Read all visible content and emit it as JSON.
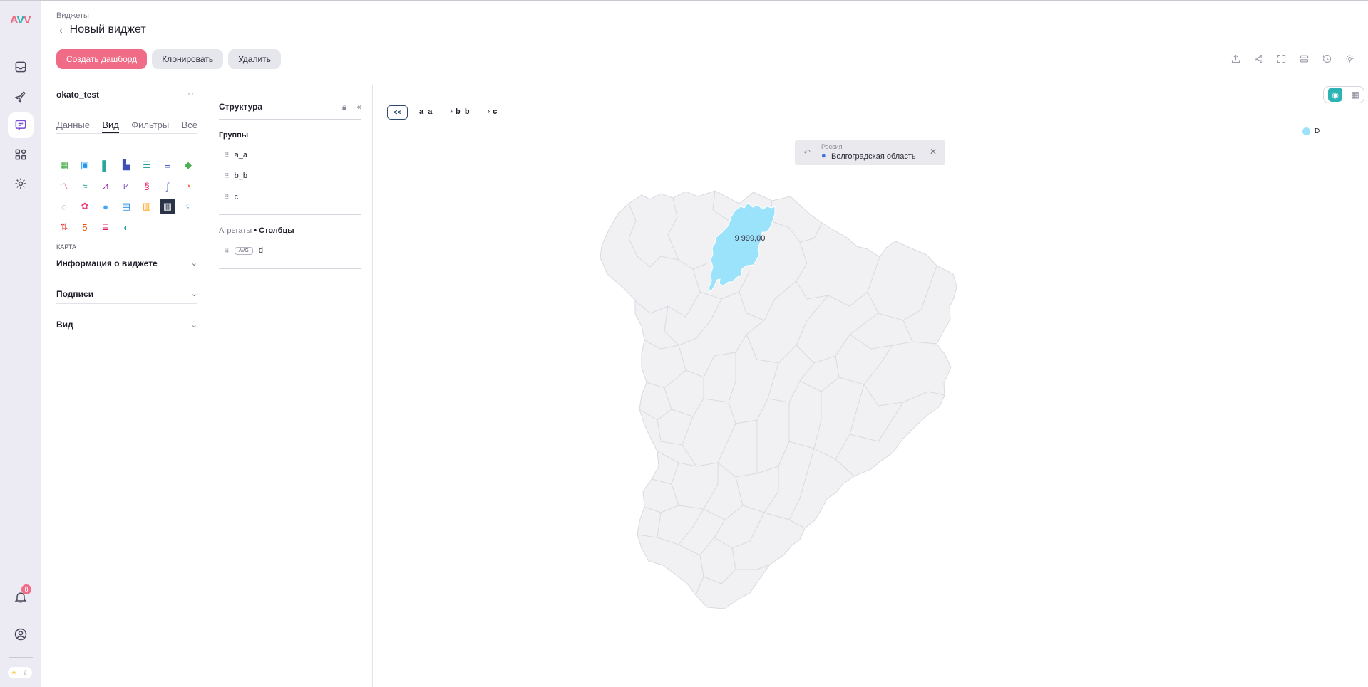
{
  "rail": {
    "logo": "AW",
    "notification_count": "8"
  },
  "header": {
    "breadcrumb": "Виджеты",
    "title": "Новый виджет",
    "actions": {
      "create_dashboard": "Создать дашборд",
      "clone": "Клонировать",
      "delete": "Удалить"
    }
  },
  "left_panel": {
    "dataset": "okato_test",
    "tabs": [
      "Данные",
      "Вид",
      "Фильтры",
      "Все"
    ],
    "active_tab": "Вид",
    "chart_icons": [
      "table-icon",
      "pivot-table-icon",
      "column-chart-icon",
      "stacked-column-icon",
      "bar-chart-icon",
      "stacked-bar-icon",
      "mosaic-icon",
      "line-chart-icon",
      "area-chart-icon",
      "multi-line-icon",
      "stacked-line-icon",
      "ribbon-icon",
      "stream-icon",
      "pie-chart-icon",
      "donut-chart-icon",
      "heatmap-icon",
      "bubble-icon",
      "treemap-icon",
      "waffle-icon",
      "map-chart-icon",
      "scatter-icon",
      "kpi-icon",
      "html-icon",
      "gantt-icon",
      "gauge-icon"
    ],
    "selected_chart": "map-chart-icon",
    "chart_type_label": "КАРТА",
    "sections": [
      "Информация о виджете",
      "Подписи",
      "Вид"
    ]
  },
  "structure": {
    "title": "Структура",
    "groups_title": "Группы",
    "groups": [
      "a_a",
      "b_b",
      "c"
    ],
    "aggregates_label": "Агрегаты",
    "aggregates_sep": "•",
    "aggregates_mode": "Столбцы",
    "aggregates": [
      {
        "func": "AVG",
        "field": "d"
      }
    ]
  },
  "canvas": {
    "drill_back": "<<",
    "drill_levels": [
      "a_a",
      "b_b",
      "c"
    ],
    "legend": {
      "name": "D",
      "color": "#9be2fb"
    },
    "location": {
      "parent": "Россия",
      "region": "Волгоградская область"
    },
    "highlighted_value": "9 999,00",
    "highlight_color": "#9be2fb",
    "base_color": "#f1f1f4",
    "border_color": "#d9d9df"
  }
}
